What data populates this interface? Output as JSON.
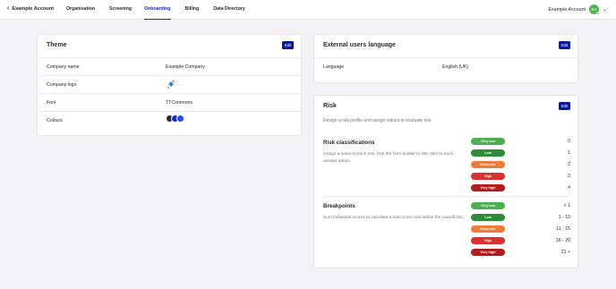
{
  "nav": {
    "back_label": "Example Account",
    "tabs": [
      {
        "label": "Organisation",
        "active": false
      },
      {
        "label": "Screening",
        "active": false
      },
      {
        "label": "Onboarding",
        "active": true
      },
      {
        "label": "Billing",
        "active": false
      },
      {
        "label": "Data Directory",
        "active": false
      }
    ],
    "account_name": "Example Account",
    "avatar_initials": "EA"
  },
  "theme": {
    "title": "Theme",
    "edit_label": "Edit",
    "rows": [
      {
        "label": "Company name",
        "value": "Example Company"
      },
      {
        "label": "Company logo",
        "value": ""
      },
      {
        "label": "Font",
        "value": "TTCommons"
      },
      {
        "label": "Colours",
        "value": ""
      }
    ],
    "colours": [
      "#2b2b2e",
      "#1a2cc9",
      "#1f4dff"
    ]
  },
  "language": {
    "title": "External users language",
    "edit_label": "Edit",
    "label": "Language",
    "value": "English (UK)"
  },
  "risk": {
    "title": "Risk",
    "edit_label": "Edit",
    "description": "Design a risk profile and assign values to evaluate risk.",
    "classifications": {
      "title": "Risk classifications",
      "description": "Assign a value to each risk. Use the form builder to link risks to each answer option.",
      "levels": [
        {
          "label": "Very low",
          "value": "0",
          "color": "#4caf50"
        },
        {
          "label": "Low",
          "value": "1",
          "color": "#2e8b3a"
        },
        {
          "label": "Moderate",
          "value": "2",
          "color": "#f07a3a"
        },
        {
          "label": "High",
          "value": "3",
          "color": "#dd3131"
        },
        {
          "label": "Very high",
          "value": "4",
          "color": "#b01c1c"
        }
      ]
    },
    "breakpoints": {
      "title": "Breakpoints",
      "description": "Sum individual scores to calculate a total score and define the overall risk.",
      "levels": [
        {
          "label": "Very low",
          "value": "< 1",
          "color": "#4caf50"
        },
        {
          "label": "Low",
          "value": "1 - 10",
          "color": "#2e8b3a"
        },
        {
          "label": "Moderate",
          "value": "11 - 15",
          "color": "#f07a3a"
        },
        {
          "label": "High",
          "value": "16 - 20",
          "color": "#dd3131"
        },
        {
          "label": "Very high",
          "value": "21 >",
          "color": "#b01c1c"
        }
      ]
    }
  }
}
